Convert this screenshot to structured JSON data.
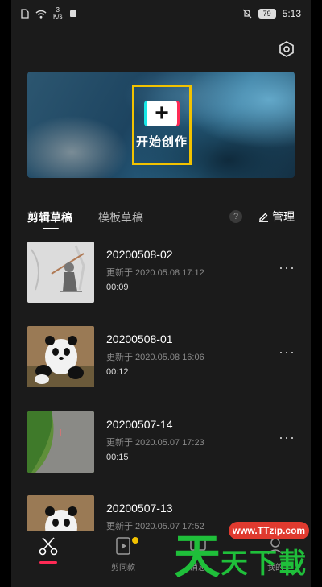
{
  "status_bar": {
    "net_speed_value": "3",
    "net_speed_unit": "K/s",
    "battery": "79",
    "time": "5:13"
  },
  "banner": {
    "start_label": "开始创作"
  },
  "tabs": {
    "drafts": "剪辑草稿",
    "templates": "模板草稿",
    "help": "?",
    "manage": "管理"
  },
  "drafts": [
    {
      "title": "20200508-02",
      "updated": "更新于 2020.05.08 17:12",
      "duration": "00:09",
      "thumb": "sketch"
    },
    {
      "title": "20200508-01",
      "updated": "更新于 2020.05.08 16:06",
      "duration": "00:12",
      "thumb": "panda"
    },
    {
      "title": "20200507-14",
      "updated": "更新于 2020.05.07 17:23",
      "duration": "00:15",
      "thumb": "road"
    },
    {
      "title": "20200507-13",
      "updated": "更新于 2020.05.07 17:52",
      "duration": "",
      "thumb": "panda"
    }
  ],
  "bottom_nav": [
    {
      "label": "",
      "icon": "scissors-icon",
      "active": true
    },
    {
      "label": "剪同款",
      "icon": "template-icon",
      "badge": true
    },
    {
      "label": "消息",
      "icon": "message-icon"
    },
    {
      "label": "我的",
      "icon": "profile-icon"
    }
  ],
  "watermark": {
    "url": "www.TTzip.com",
    "glyph_1": "天",
    "glyph_2": "天",
    "glyph_3": "下",
    "glyph_4": "載"
  },
  "colors": {
    "accent_red": "#ff2a55",
    "accent_cyan": "#19e6e6",
    "frame_yellow": "#f2c200",
    "background": "#1b1b1b",
    "watermark_green": "#1fbf3a"
  }
}
